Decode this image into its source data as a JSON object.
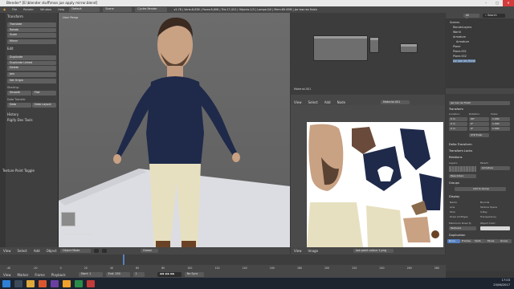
{
  "window": {
    "title": "Blender* [E:\\blender stuff\\man jue apply mirror.blend]",
    "controls": [
      "–",
      "▢",
      "✕"
    ]
  },
  "infobar": {
    "menus": [
      "File",
      "Render",
      "Window",
      "Help"
    ],
    "layout": "Default",
    "scene": "Scene",
    "engine": "Cycles Render",
    "stats": "v2.78 | Verts:8,838 | Faces:8,808 | Tris:17,412 | Objects:1/3 | Lamps:0/0 | Mem:89.45M | jse low res finish"
  },
  "toolshelf": {
    "sections": {
      "transform": "Transform",
      "edit": "Edit",
      "shading": "Shading:",
      "data_transfer": "Data Transfer",
      "history": "History",
      "rigify": "Rigify Dev Tools",
      "texture_paint_toggle": "Texture Paint Toggle"
    },
    "buttons": {
      "translate": "Translate",
      "rotate": "Rotate",
      "scale": "Scale",
      "mirror": "Mirror",
      "duplicate": "Duplicate",
      "duplicate_linked": "Duplicate Linked",
      "delete": "Delete",
      "join": "Join",
      "set_origin": "Set Origin",
      "smooth": "Smooth",
      "flat": "Flat",
      "data": "Data",
      "data_layout": "Data Layout"
    }
  },
  "viewport": {
    "label": "User Persp",
    "paint_label": "Low Texture Paint Toggle",
    "mode": "Object Mode",
    "menus": [
      "View",
      "Select",
      "Add",
      "Object"
    ],
    "pivot": "Global"
  },
  "node_editor": {
    "material_label": "Material.001"
  },
  "image_editor": {
    "menus": [
      "View",
      "Select",
      "Add",
      "Node"
    ],
    "material": "Material.001",
    "image_name": "low paint colour 1.png",
    "bottom_menus": [
      "View",
      "Image"
    ]
  },
  "outliner": {
    "view": "All Scenes",
    "search_placeholder": "Search",
    "items": [
      "Scenes",
      "RenderLayers",
      "World",
      "Armature",
      "Armature",
      "Plane",
      "Plane.001",
      "Plane.002",
      "jse low res finish"
    ]
  },
  "properties": {
    "object_name": "jse low res finish",
    "sections": {
      "transform": "Transform",
      "location": "Location:",
      "rotation": "Rotation:",
      "scale": "Scale:",
      "rotation_mode": "XYZ Euler",
      "delta": "Delta Transform",
      "locks": "Transform Locks",
      "relations": "Relations",
      "layers": "Layers:",
      "parent": "Parent:",
      "parent_value": "Armature",
      "pass_index": "Pass Index:",
      "groups": "Groups",
      "add_group": "Add to Group",
      "display": "Display",
      "duplication": "Duplication"
    },
    "loc": [
      "0 m",
      "0 m",
      "0 m"
    ],
    "rot": [
      "90°",
      "0°",
      "0°"
    ],
    "scl": [
      "1.000",
      "1.000",
      "1.000"
    ],
    "display_checks": [
      "Name",
      "Axis",
      "Wire",
      "Draw All Edges"
    ],
    "display_checks_right": [
      "Bounds",
      "Texture Space",
      "X-Ray",
      "Transparency"
    ],
    "maximum_draw": "Maximum Draw Ty",
    "object_color": "Object Color:",
    "textured": "Textured",
    "dup_tabs": [
      "None",
      "Frames",
      "Verts",
      "Faces",
      "Group"
    ]
  },
  "timeline": {
    "menus": [
      "View",
      "Marker",
      "Frame",
      "Playback"
    ],
    "start": "Start:",
    "start_val": "1",
    "end": "End:",
    "end_val": "250",
    "current": "1",
    "sync": "No Sync",
    "ticks": [
      "-40",
      "-20",
      "0",
      "20",
      "40",
      "60",
      "80",
      "100",
      "120",
      "140",
      "160",
      "180",
      "200",
      "220",
      "240",
      "260",
      "280"
    ]
  },
  "taskbar": {
    "time": "17:03",
    "date": "25/06/2017"
  },
  "colors": {
    "accent": "#5680c2",
    "panel": "#3d3d3d",
    "header": "#474747",
    "close": "#d43c3c"
  }
}
